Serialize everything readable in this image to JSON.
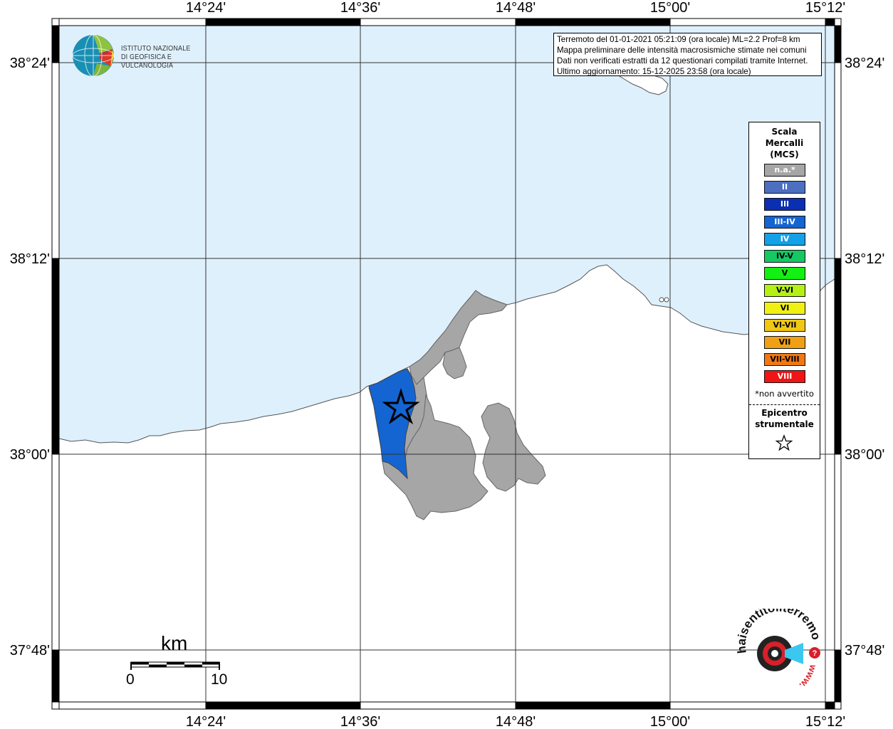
{
  "info": {
    "line1": "Terremoto del 01-01-2021 05:21:09 (ora locale) ML=2.2 Prof=8 km",
    "line2": "Mappa preliminare delle intensità macrosismiche stimate nei comuni",
    "line3": "Dati non verificati estratti da 12 questionari compilati tramite Internet.",
    "line4": "Ultimo aggiornamento: 15-12-2025 23:58 (ora locale)"
  },
  "axes": {
    "lon_labels": [
      "14°24'",
      "14°36'",
      "14°48'",
      "15°00'",
      "15°12'"
    ],
    "lat_labels": [
      "38°24'",
      "38°12'",
      "38°00'",
      "37°48'"
    ]
  },
  "legend": {
    "title1": "Scala",
    "title2": "Mercalli",
    "title3": "(MCS)",
    "items": [
      {
        "label": "n.a.*",
        "color": "#a6a6a6"
      },
      {
        "label": "II",
        "color": "#4c6fc1"
      },
      {
        "label": "III",
        "color": "#0a2fb3"
      },
      {
        "label": "III-IV",
        "color": "#1464d2"
      },
      {
        "label": "IV",
        "color": "#14a0e6"
      },
      {
        "label": "IV-V",
        "color": "#14c864"
      },
      {
        "label": "V",
        "color": "#14f014"
      },
      {
        "label": "V-VI",
        "color": "#b4f014"
      },
      {
        "label": "VI",
        "color": "#f0f014"
      },
      {
        "label": "VI-VII",
        "color": "#f0c814"
      },
      {
        "label": "VII",
        "color": "#f0a014"
      },
      {
        "label": "VII-VIII",
        "color": "#f07814"
      },
      {
        "label": "VIII",
        "color": "#f01414"
      }
    ],
    "note": "*non avvertito",
    "epicentre1": "Epicentro",
    "epicentre2": "strumentale"
  },
  "logo": {
    "line1": "ISTITUTO NAZIONALE",
    "line2": "DI GEOFISICA E VULCANOLOGIA"
  },
  "hst_logo": {
    "text": "haisentitoilterremoto.it",
    "url": "www."
  },
  "scale_bar": {
    "unit": "km",
    "start": "0",
    "end": "10"
  },
  "colors": {
    "sea": "#dff0fd",
    "land": "#ffffff",
    "municipality_na": "#a6a6a6",
    "municipality_felt": "#1464d2"
  }
}
